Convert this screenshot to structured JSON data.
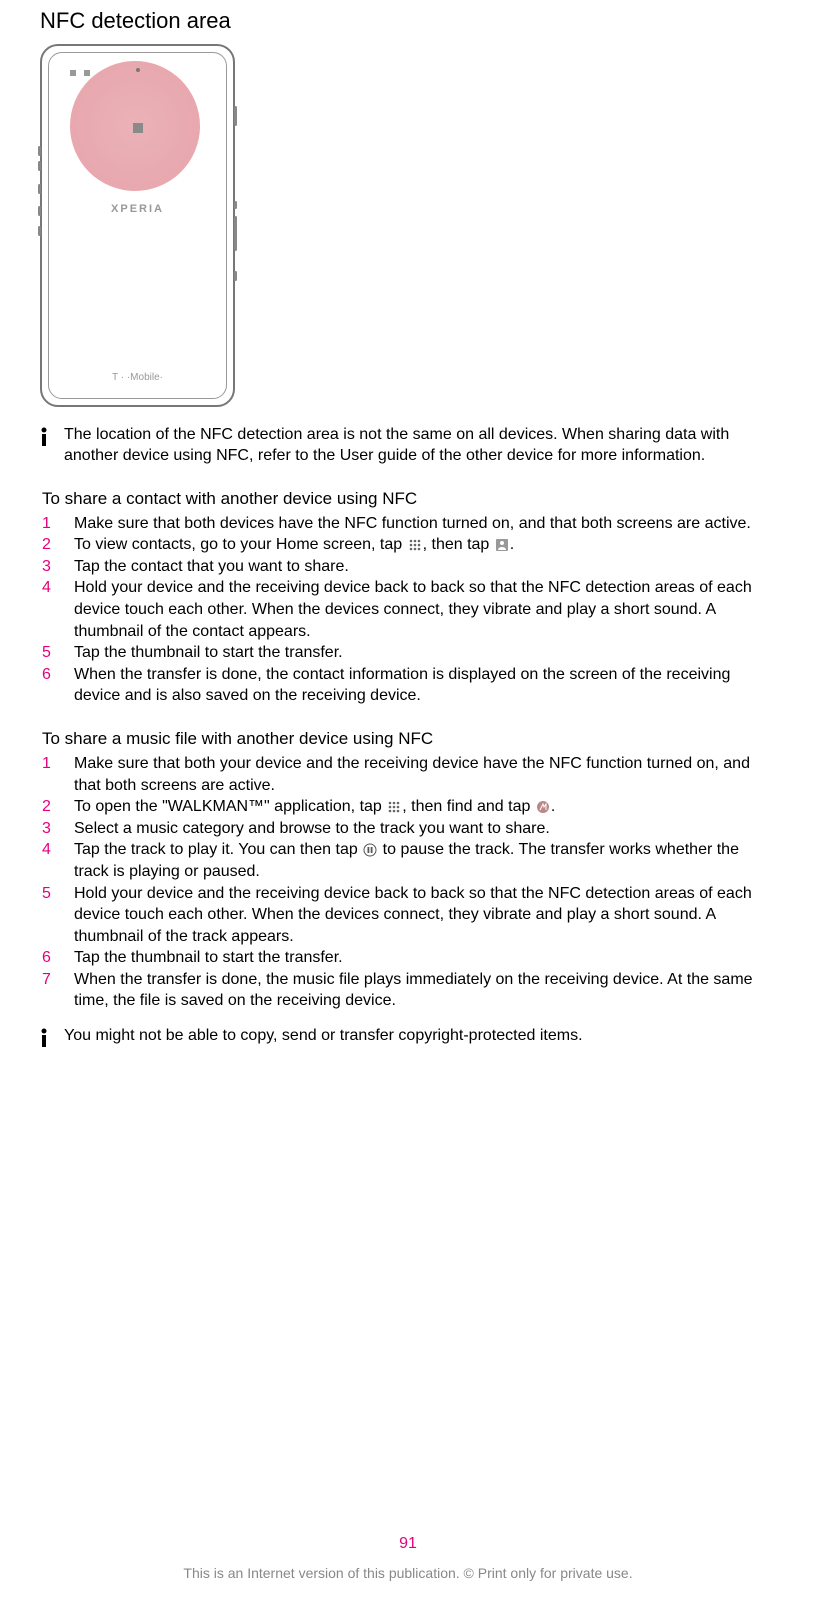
{
  "title": "NFC detection area",
  "phone": {
    "brand": "XPERIA",
    "carrier": "T · ·Mobile·"
  },
  "note1": "The location of the NFC detection area is not the same on all devices. When sharing data with another device using NFC, refer to the User guide of the other device for more information.",
  "section1": {
    "heading": "To share a contact with another device using NFC",
    "steps": [
      "Make sure that both devices have the NFC function turned on, and that both screens are active.",
      "__STEP2_CONTACT__",
      "Tap the contact that you want to share.",
      "Hold your device and the receiving device back to back so that the NFC detection areas of each device touch each other. When the devices connect, they vibrate and play a short sound. A thumbnail of the contact appears.",
      "Tap the thumbnail to start the transfer.",
      "When the transfer is done, the contact information is displayed on the screen of the receiving device and is also saved on the receiving device."
    ],
    "step2_parts": {
      "a": "To view contacts, go to your Home screen, tap ",
      "b": ", then tap ",
      "c": "."
    }
  },
  "section2": {
    "heading": "To share a music file with another device using NFC",
    "steps": [
      "Make sure that both your device and the receiving device have the NFC function turned on, and that both screens are active.",
      "__STEP2_MUSIC__",
      "Select a music category and browse to the track you want to share.",
      "__STEP4_MUSIC__",
      "Hold your device and the receiving device back to back so that the NFC detection areas of each device touch each other. When the devices connect, they vibrate and play a short sound. A thumbnail of the track appears.",
      "Tap the thumbnail to start the transfer.",
      "When the transfer is done, the music file plays immediately on the receiving device. At the same time, the file is saved on the receiving device."
    ],
    "step2_parts": {
      "a": "To open the \"WALKMAN™\" application, tap ",
      "b": ", then find and tap ",
      "c": "."
    },
    "step4_parts": {
      "a": "Tap the track to play it. You can then tap ",
      "b": " to pause the track. The transfer works whether the track is playing or paused."
    }
  },
  "note2": "You might not be able to copy, send or transfer copyright-protected items.",
  "page_number": "91",
  "footer": "This is an Internet version of this publication. © Print only for private use."
}
